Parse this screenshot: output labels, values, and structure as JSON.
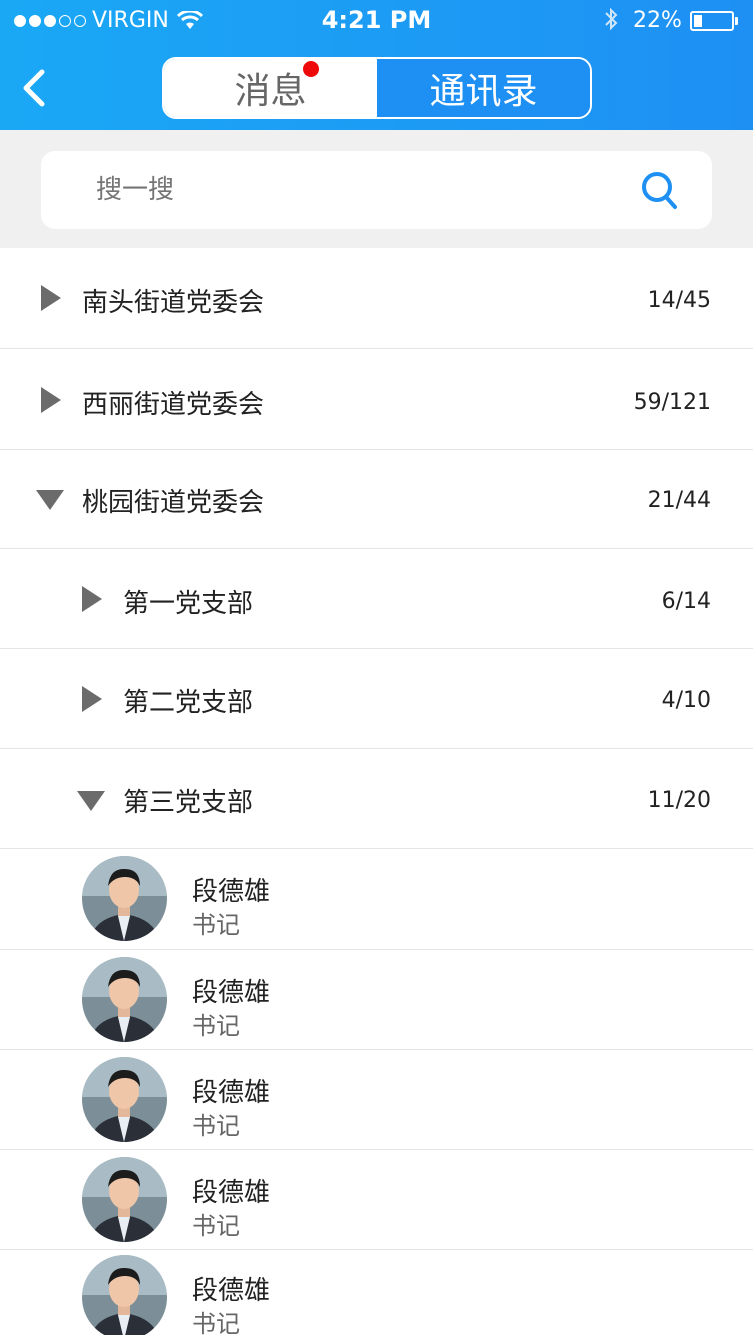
{
  "status_bar": {
    "carrier": "VIRGIN",
    "time": "4:21 PM",
    "battery": "22%"
  },
  "header": {
    "tabs": [
      {
        "label": "消息",
        "active": true
      },
      {
        "label": "通讯录",
        "active": false
      }
    ]
  },
  "search": {
    "placeholder": "搜一搜"
  },
  "groups": [
    {
      "title": "南头街道党委会",
      "count": "14/45",
      "expanded": false
    },
    {
      "title": "西丽街道党委会",
      "count": "59/121",
      "expanded": false
    },
    {
      "title": "桃园街道党委会",
      "count": "21/44",
      "expanded": true
    }
  ],
  "branches": [
    {
      "title": "第一党支部",
      "count": "6/14",
      "expanded": false
    },
    {
      "title": "第二党支部",
      "count": "4/10",
      "expanded": false
    },
    {
      "title": "第三党支部",
      "count": "11/20",
      "expanded": true
    }
  ],
  "members": [
    {
      "name": "段德雄",
      "role": "书记"
    },
    {
      "name": "段德雄",
      "role": "书记"
    },
    {
      "name": "段德雄",
      "role": "书记"
    },
    {
      "name": "段德雄",
      "role": "书记"
    },
    {
      "name": "段德雄",
      "role": "书记"
    }
  ],
  "colors": {
    "header_blue": "#1e90f4",
    "search_bg": "#f0f0f0",
    "divider": "#e5e5e5",
    "text_primary": "#222222",
    "text_secondary": "#666666",
    "search_icon": "#1e90f4",
    "badge": "#ee0a0a"
  }
}
